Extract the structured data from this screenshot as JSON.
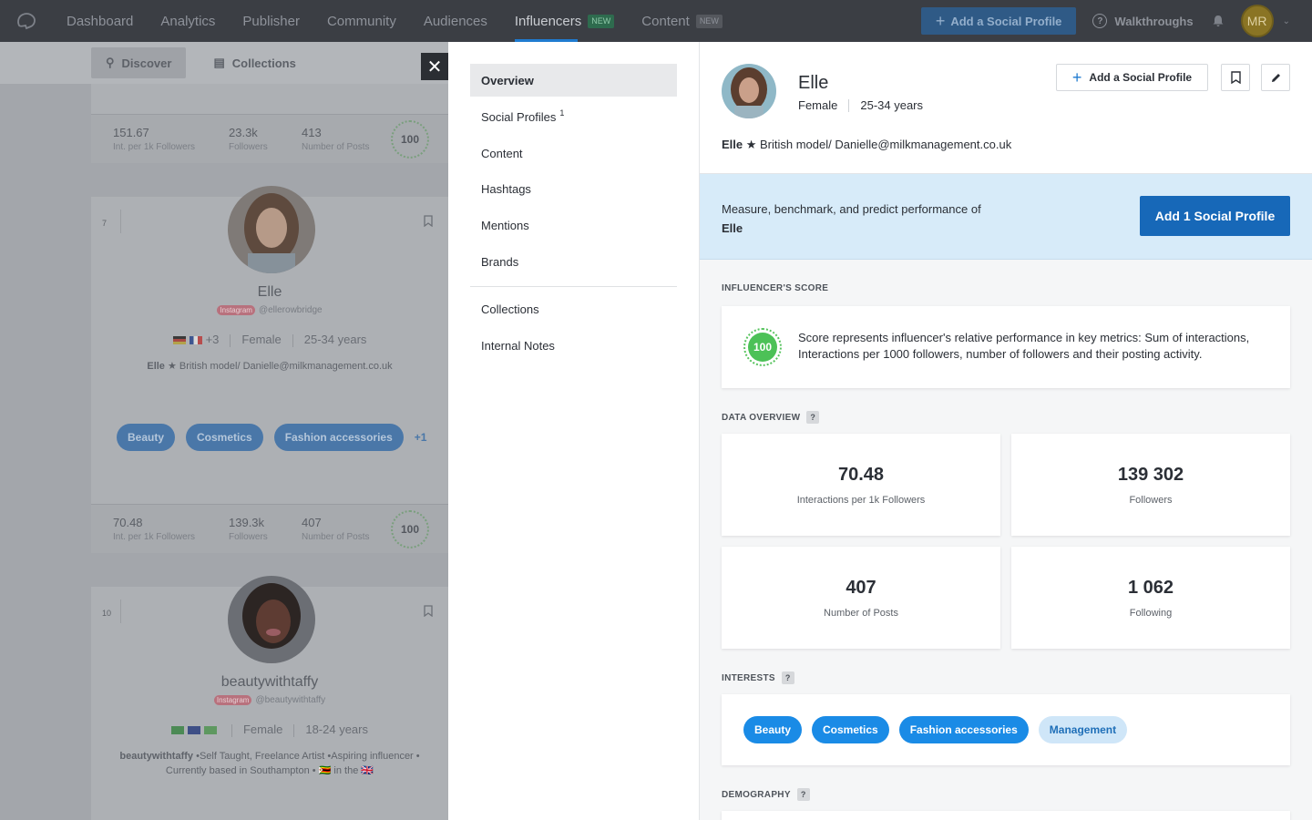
{
  "topnav": {
    "items": [
      {
        "label": "Dashboard"
      },
      {
        "label": "Analytics"
      },
      {
        "label": "Publisher"
      },
      {
        "label": "Community"
      },
      {
        "label": "Audiences"
      },
      {
        "label": "Influencers",
        "badge": "NEW"
      },
      {
        "label": "Content",
        "badge": "NEW"
      }
    ],
    "add_profile_label": "Add a Social Profile",
    "walkthroughs_label": "Walkthroughs",
    "user_initials": "MR"
  },
  "leftlist": {
    "tabs": [
      {
        "label": "Discover"
      },
      {
        "label": "Collections"
      }
    ],
    "top_stats": [
      {
        "value": "151.67",
        "label": "Int. per 1k Followers"
      },
      {
        "value": "23.3k",
        "label": "Followers"
      },
      {
        "value": "413",
        "label": "Number of Posts"
      }
    ],
    "top_score": "100",
    "cards": [
      {
        "rank": "7",
        "name": "Elle",
        "network": "Instagram",
        "handle": "@ellerowbridge",
        "extra_flags": "+3",
        "gender": "Female",
        "age": "25-34 years",
        "bio_name": "Elle",
        "bio": " ★ British model/ Danielle@milkmanagement.co.uk",
        "tags": [
          "Beauty",
          "Cosmetics",
          "Fashion accessories"
        ],
        "more_tags": "+1",
        "stats": [
          {
            "value": "70.48",
            "label": "Int. per 1k Followers"
          },
          {
            "value": "139.3k",
            "label": "Followers"
          },
          {
            "value": "407",
            "label": "Number of Posts"
          }
        ],
        "score": "100"
      },
      {
        "rank": "10",
        "name": "beautywithtaffy",
        "network": "Instagram",
        "handle": "@beautywithtaffy",
        "gender": "Female",
        "age": "18-24 years",
        "bio_name": "beautywithtaffy",
        "bio": " •Self Taught, Freelance Artist •Aspiring influencer • Currently based in Southampton • 🇿🇼 in the 🇬🇧"
      }
    ]
  },
  "midnav": {
    "items": [
      {
        "label": "Overview"
      },
      {
        "label": "Social Profiles",
        "count": "1"
      },
      {
        "label": "Content"
      },
      {
        "label": "Hashtags"
      },
      {
        "label": "Mentions"
      },
      {
        "label": "Brands"
      }
    ],
    "items2": [
      {
        "label": "Collections"
      },
      {
        "label": "Internal Notes"
      }
    ]
  },
  "detail": {
    "name": "Elle",
    "gender": "Female",
    "age": "25-34 years",
    "bio_name": "Elle",
    "bio": " ★ British model/ Danielle@milkmanagement.co.uk",
    "add_profile_label": "Add a Social Profile",
    "banner_text": "Measure, benchmark, and predict performance of ",
    "banner_name": "Elle",
    "banner_button": "Add 1 Social Profile",
    "score_heading": "INFLUENCER'S SCORE",
    "score": "100",
    "score_text": "Score represents influencer's relative performance in key metrics: Sum of interactions, Interactions per 1000 followers, number of followers and their posting activity.",
    "data_heading": "DATA OVERVIEW",
    "stats": [
      {
        "value": "70.48",
        "label": "Interactions per 1k Followers"
      },
      {
        "value": "139 302",
        "label": "Followers"
      },
      {
        "value": "407",
        "label": "Number of Posts"
      },
      {
        "value": "1 062",
        "label": "Following"
      }
    ],
    "interests_heading": "INTERESTS",
    "interests": [
      {
        "label": "Beauty",
        "style": "blue"
      },
      {
        "label": "Cosmetics",
        "style": "blue"
      },
      {
        "label": "Fashion accessories",
        "style": "blue"
      },
      {
        "label": "Management",
        "style": "light"
      }
    ],
    "demography_heading": "DEMOGRAPHY"
  },
  "colors": {
    "accent": "#1768b8",
    "tag_blue": "#1a8be6",
    "score_green": "#4cc157",
    "banner_bg": "#d7ebf9",
    "nav_bg": "#3b3e44"
  },
  "icons": [
    "logo-icon",
    "plus-icon",
    "help-circle-icon",
    "bell-icon",
    "chevron-down-icon",
    "search-icon",
    "clipboard-icon",
    "close-icon",
    "bookmark-icon",
    "pencil-icon"
  ]
}
